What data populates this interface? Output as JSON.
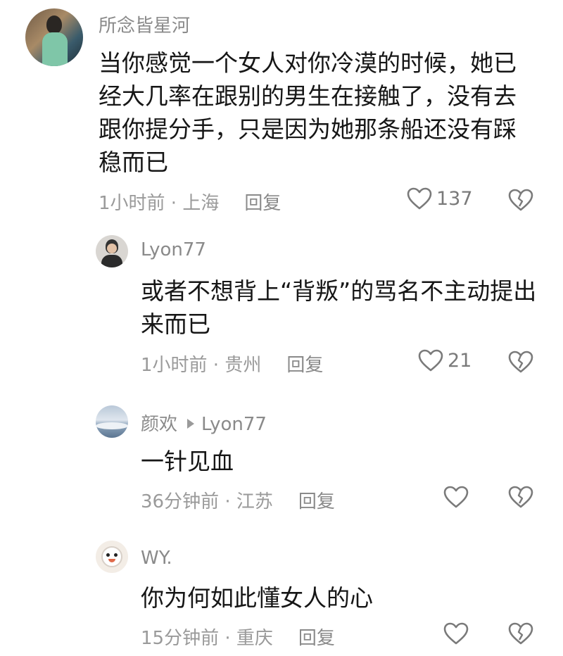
{
  "comments": [
    {
      "username": "所念皆星河",
      "text": "当你感觉一个女人对你冷漠的时候，她已经大几率在跟别的男生在接触了，没有去跟你提分手，只是因为她那条船还没有踩稳而已",
      "meta": "1小时前 · 上海",
      "reply": "回复",
      "likes": "137",
      "avatar_icon": "person-photo-avatar"
    },
    {
      "username": "Lyon77",
      "text": "或者不想背上“背叛”的骂名不主动提出来而已",
      "meta": "1小时前 · 贵州",
      "reply": "回复",
      "likes": "21",
      "avatar_icon": "person-photo-avatar"
    },
    {
      "username": "颜欢",
      "reply_to": "Lyon77",
      "text": "一针见血",
      "meta": "36分钟前 · 江苏",
      "reply": "回复",
      "likes": "",
      "avatar_icon": "landscape-avatar"
    },
    {
      "username": "WY.",
      "text": "你为何如此懂女人的心",
      "meta": "15分钟前 · 重庆",
      "reply": "回复",
      "likes": "",
      "avatar_icon": "cartoon-avatar"
    }
  ],
  "icons": {
    "like": "heart-outline-icon",
    "dislike": "broken-heart-icon"
  },
  "colors": {
    "text": "#161616",
    "secondary": "#8a8a8a",
    "icon": "#7a7a7a"
  }
}
